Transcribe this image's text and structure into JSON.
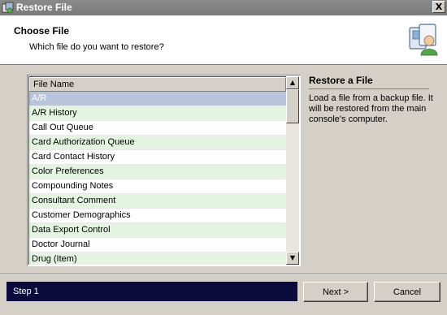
{
  "window": {
    "title": "Restore File",
    "close_label": "X"
  },
  "header": {
    "title": "Choose File",
    "subtitle": "Which file do you want to restore?"
  },
  "file_list": {
    "column_header": "File Name",
    "selected_index": 0,
    "rows": [
      "A/R",
      "A/R History",
      "Call Out Queue",
      "Card Authorization Queue",
      "Card Contact History",
      "Color Preferences",
      "Compounding Notes",
      "Consultant Comment",
      "Customer Demographics",
      "Data Export Control",
      "Doctor Journal",
      "Drug (Item)"
    ]
  },
  "info": {
    "title": "Restore a File",
    "text": "Load a file from a backup file. It will be restored from the main console's computer."
  },
  "footer": {
    "step": "Step 1",
    "next_label": "Next >",
    "cancel_label": "Cancel"
  },
  "colors": {
    "titlebar": "#7f7f7f",
    "even_row": "#e3f5e1",
    "selected_row": "#b8c4dc",
    "step_bar": "#0a0a3c"
  },
  "icons": {
    "title": "restore-file-icon",
    "header": "computer-user-icon",
    "close": "close-icon"
  }
}
